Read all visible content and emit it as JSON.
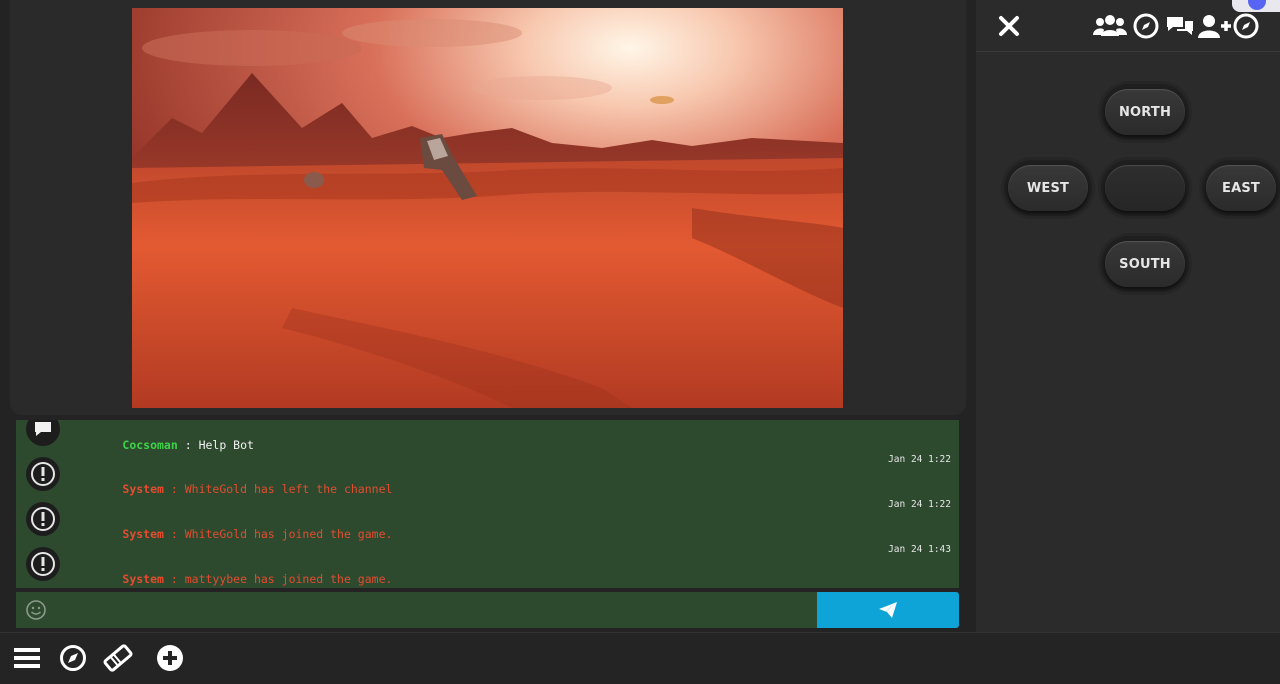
{
  "chat": {
    "messages": [
      {
        "sender": "Cocsoman",
        "text": "Help Bot",
        "timestamp": "",
        "type": "user",
        "avatar_icon": "chat-bubble-icon"
      },
      {
        "sender": "System",
        "text": "WhiteGold has left the channel",
        "timestamp": "Jan 24 1:22",
        "type": "system",
        "avatar_icon": "exclamation-icon"
      },
      {
        "sender": "System",
        "text": "WhiteGold has joined the game.",
        "timestamp": "Jan 24 1:22",
        "type": "system",
        "avatar_icon": "exclamation-icon"
      },
      {
        "sender": "System",
        "text": "mattyybee has joined the game.",
        "timestamp": "Jan 24 1:43",
        "type": "system",
        "avatar_icon": "exclamation-icon"
      }
    ],
    "separator": " : ",
    "input_value": "",
    "input_placeholder": ""
  },
  "compass": {
    "north": "NORTH",
    "south": "SOUTH",
    "east": "EAST",
    "west": "WEST"
  },
  "colors": {
    "system_text": "#e34c2f",
    "user_name": "#3fd14a",
    "chat_bg": "#2d4a2f",
    "send_button": "#0ea4d8"
  }
}
